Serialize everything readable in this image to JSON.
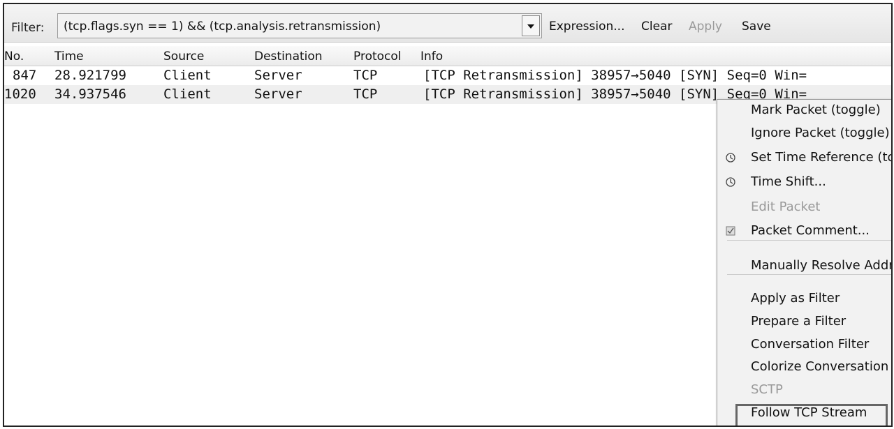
{
  "filter": {
    "label": "Filter:",
    "value": "(tcp.flags.syn == 1) && (tcp.analysis.retransmission)",
    "buttons": {
      "expression": "Expression...",
      "clear": "Clear",
      "apply": "Apply",
      "save": "Save"
    }
  },
  "columns": [
    "No.",
    "Time",
    "Source",
    "Destination",
    "Protocol",
    "Info"
  ],
  "rows": [
    [
      "847",
      "28.921799",
      "Client",
      "Server",
      "TCP",
      "[TCP Retransmission] 38957→5040 [SYN] Seq=0 Win="
    ],
    [
      "1020",
      "34.937546",
      "Client",
      "Server",
      "TCP",
      "[TCP Retransmission] 38957→5040 [SYN] Seq=0 Win="
    ]
  ],
  "context_menu": {
    "items": [
      {
        "label": "Mark Packet (toggle)",
        "icon": "",
        "disabled": false
      },
      {
        "label": "Ignore Packet (toggle)",
        "icon": "",
        "disabled": false
      },
      {
        "label": "Set Time Reference (toggle)",
        "icon": "clock-icon",
        "disabled": false
      },
      {
        "label": "Time Shift...",
        "icon": "clock-icon",
        "disabled": false
      },
      {
        "label": "Edit Packet",
        "icon": "",
        "disabled": true
      },
      {
        "label": "Packet Comment...",
        "icon": "comment-icon",
        "disabled": false
      },
      {
        "label": "Manually Resolve Address",
        "icon": "",
        "disabled": false
      },
      {
        "label": "Apply as Filter",
        "icon": "",
        "disabled": false
      },
      {
        "label": "Prepare a Filter",
        "icon": "",
        "disabled": false
      },
      {
        "label": "Conversation Filter",
        "icon": "",
        "disabled": false
      },
      {
        "label": "Colorize Conversation",
        "icon": "",
        "disabled": false
      },
      {
        "label": "SCTP",
        "icon": "",
        "disabled": true
      },
      {
        "label": "Follow TCP Stream",
        "icon": "",
        "disabled": false,
        "highlighted": true
      }
    ]
  }
}
